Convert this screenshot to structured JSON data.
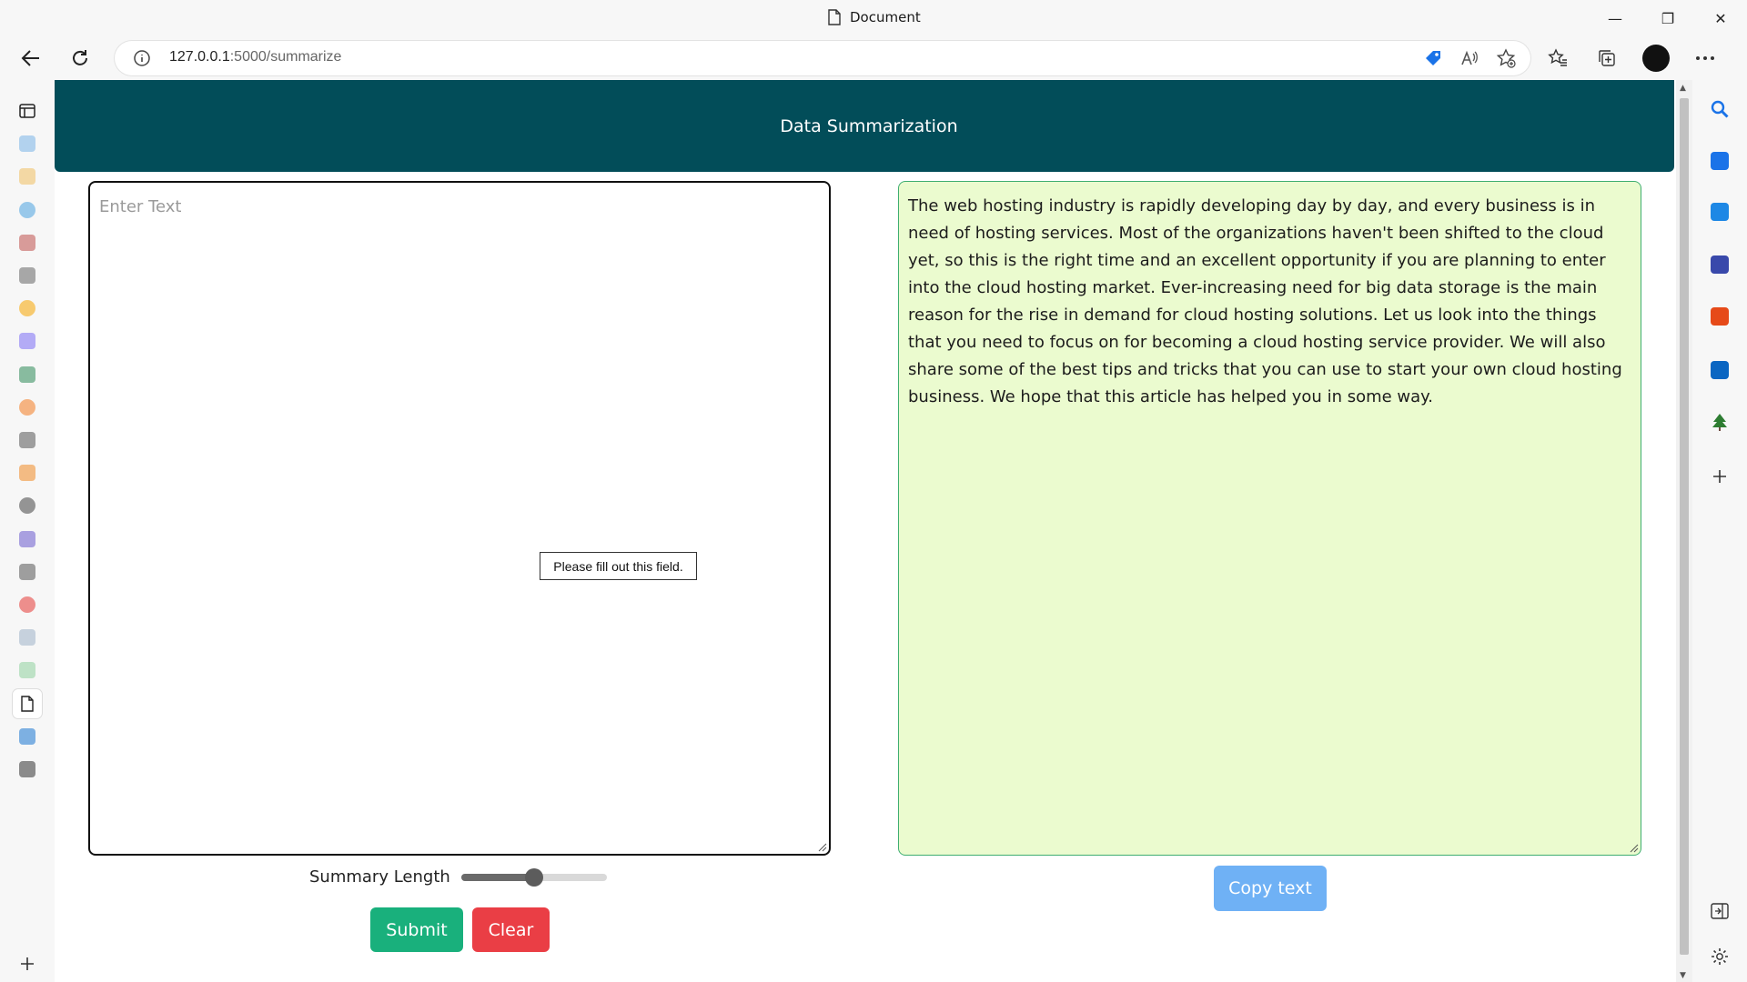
{
  "window": {
    "title": "Document",
    "controls": {
      "minimize": "—",
      "maximize": "❐",
      "close": "✕"
    }
  },
  "toolbar": {
    "url_host": "127.0.0.1",
    "url_rest": ":5000/summarize"
  },
  "left_tabs": [
    {
      "icon": "sidebar-toggle-icon",
      "color": "#222222"
    },
    {
      "icon": "back-chevron-favicon",
      "color": "#7ab4e8"
    },
    {
      "icon": "infinity-favicon",
      "color": "#f0c060"
    },
    {
      "icon": "k-favicon",
      "color": "#4aa3e0"
    },
    {
      "icon": "crest-favicon",
      "color": "#c0504d"
    },
    {
      "icon": "text-logo-favicon",
      "color": "#666666"
    },
    {
      "icon": "bitcoin-favicon",
      "color": "#f7a600"
    },
    {
      "icon": "c-circle-favicon",
      "color": "#7b6ef6"
    },
    {
      "icon": "image-favicon",
      "color": "#2e8b57"
    },
    {
      "icon": "orange-circle-favicon",
      "color": "#f47c20"
    },
    {
      "icon": "chart-line-favicon",
      "color": "#555555"
    },
    {
      "icon": "sun-favicon",
      "color": "#f08a24"
    },
    {
      "icon": "swimmer-favicon",
      "color": "#444444"
    },
    {
      "icon": "planet-favicon",
      "color": "#6a5acd"
    },
    {
      "icon": "c-square-favicon",
      "color": "#555555"
    },
    {
      "icon": "youtube-favicon",
      "color": "#e53935"
    },
    {
      "icon": "grid-favicon",
      "color": "#9fb3c8"
    },
    {
      "icon": "square-favicon",
      "color": "#8fd19e"
    },
    {
      "icon": "document-favicon",
      "color": "#222222"
    },
    {
      "icon": "info-favicon",
      "color": "#1976d2"
    },
    {
      "icon": "owl-favicon",
      "color": "#333333"
    },
    {
      "icon": "new-tab-plus-icon",
      "color": "#333333"
    }
  ],
  "right_tools": [
    {
      "icon": "search-icon",
      "color": "#1a73e8"
    },
    {
      "icon": "shopping-tag-icon",
      "color": "#1a73e8"
    },
    {
      "icon": "toolbox-icon",
      "color": "#1e88e5"
    },
    {
      "icon": "games-icon",
      "color": "#3949ab"
    },
    {
      "icon": "office-icon",
      "color": "#e64a19"
    },
    {
      "icon": "outlook-icon",
      "color": "#0a66c2"
    },
    {
      "icon": "tree-icon",
      "color": "#2e7d32"
    },
    {
      "icon": "add-icon",
      "color": "#333333"
    }
  ],
  "page": {
    "header_title": "Data Summarization",
    "input_placeholder": "Enter Text",
    "validation_tooltip": "Please fill out this field.",
    "output_text": "The web hosting industry is rapidly developing day by day, and every business is in need of hosting services. Most of the organizations haven't been shifted to the cloud yet, so this is the right time and an excellent opportunity if you are planning to enter into the cloud hosting market. Ever-increasing need for big data storage is the main reason for the rise in demand for cloud hosting solutions. Let us look into the things that you need to focus on for becoming a cloud hosting service provider. We will also share some of the best tips and tricks that you can use to start your own cloud hosting business. We hope that this article has helped you in some way.",
    "slider_label": "Summary Length",
    "slider_value_fraction": 0.5,
    "submit_label": "Submit",
    "clear_label": "Clear",
    "copy_label": "Copy text"
  },
  "colors": {
    "header_bg": "#024d59",
    "submit": "#19b07c",
    "clear": "#ea3e45",
    "copy": "#6fb1f5",
    "output_bg": "#ebfbcf"
  }
}
